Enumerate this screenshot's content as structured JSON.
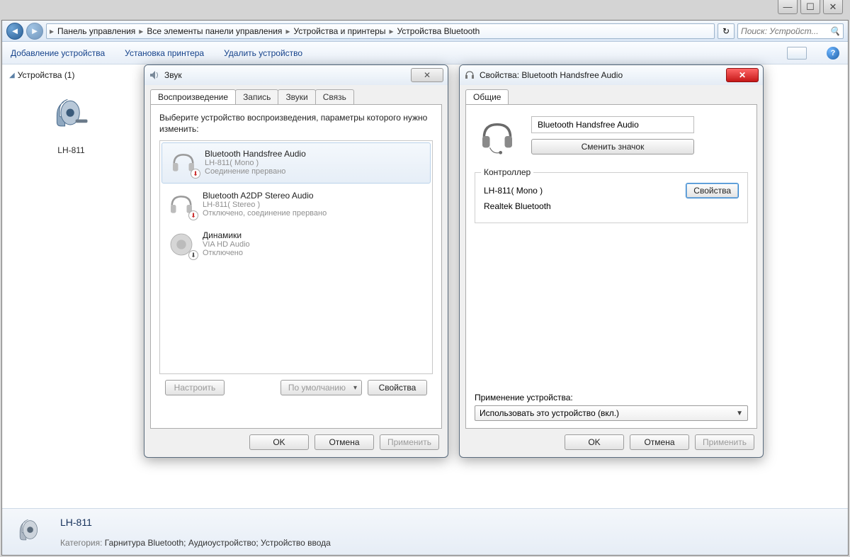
{
  "breadcrumbs": [
    "Панель управления",
    "Все элементы панели управления",
    "Устройства и принтеры",
    "Устройства Bluetooth"
  ],
  "search_placeholder": "Поиск: Устройст...",
  "commands": {
    "add": "Добавление устройства",
    "addprinter": "Установка принтера",
    "remove": "Удалить устройство"
  },
  "section": {
    "title": "Устройства (1)"
  },
  "device_tile": {
    "label": "LH-811"
  },
  "sound_dialog": {
    "title": "Звук",
    "tabs": [
      "Воспроизведение",
      "Запись",
      "Звуки",
      "Связь"
    ],
    "instruction": "Выберите устройство воспроизведения, параметры которого нужно изменить:",
    "items": [
      {
        "name": "Bluetooth Handsfree Audio",
        "sub1": "LH-811( Mono )",
        "sub2": "Соединение прервано",
        "badge": "↓"
      },
      {
        "name": "Bluetooth A2DP Stereo Audio",
        "sub1": "LH-811( Stereo )",
        "sub2": "Отключено, соединение прервано",
        "badge": "↓"
      },
      {
        "name": "Динамики",
        "sub1": "VIA HD Audio",
        "sub2": "Отключено",
        "badge": "↓"
      }
    ],
    "buttons": {
      "configure": "Настроить",
      "default": "По умолчанию",
      "props": "Свойства",
      "ok": "OK",
      "cancel": "Отмена",
      "apply": "Применить"
    }
  },
  "props_dialog": {
    "title": "Свойства: Bluetooth Handsfree Audio",
    "tab": "Общие",
    "device_name": "Bluetooth Handsfree Audio",
    "change_icon": "Сменить значок",
    "controller_legend": "Контроллер",
    "controller_line1": "LH-811( Mono )",
    "controller_line2": "Realtek Bluetooth",
    "controller_props": "Свойства",
    "usage_label": "Применение устройства:",
    "usage_value": "Использовать это устройство (вкл.)",
    "buttons": {
      "ok": "OK",
      "cancel": "Отмена",
      "apply": "Применить"
    }
  },
  "details": {
    "name": "LH-811",
    "category_label": "Категория:",
    "category_value": "Гарнитура Bluetooth; Аудиоустройство; Устройство ввода"
  }
}
